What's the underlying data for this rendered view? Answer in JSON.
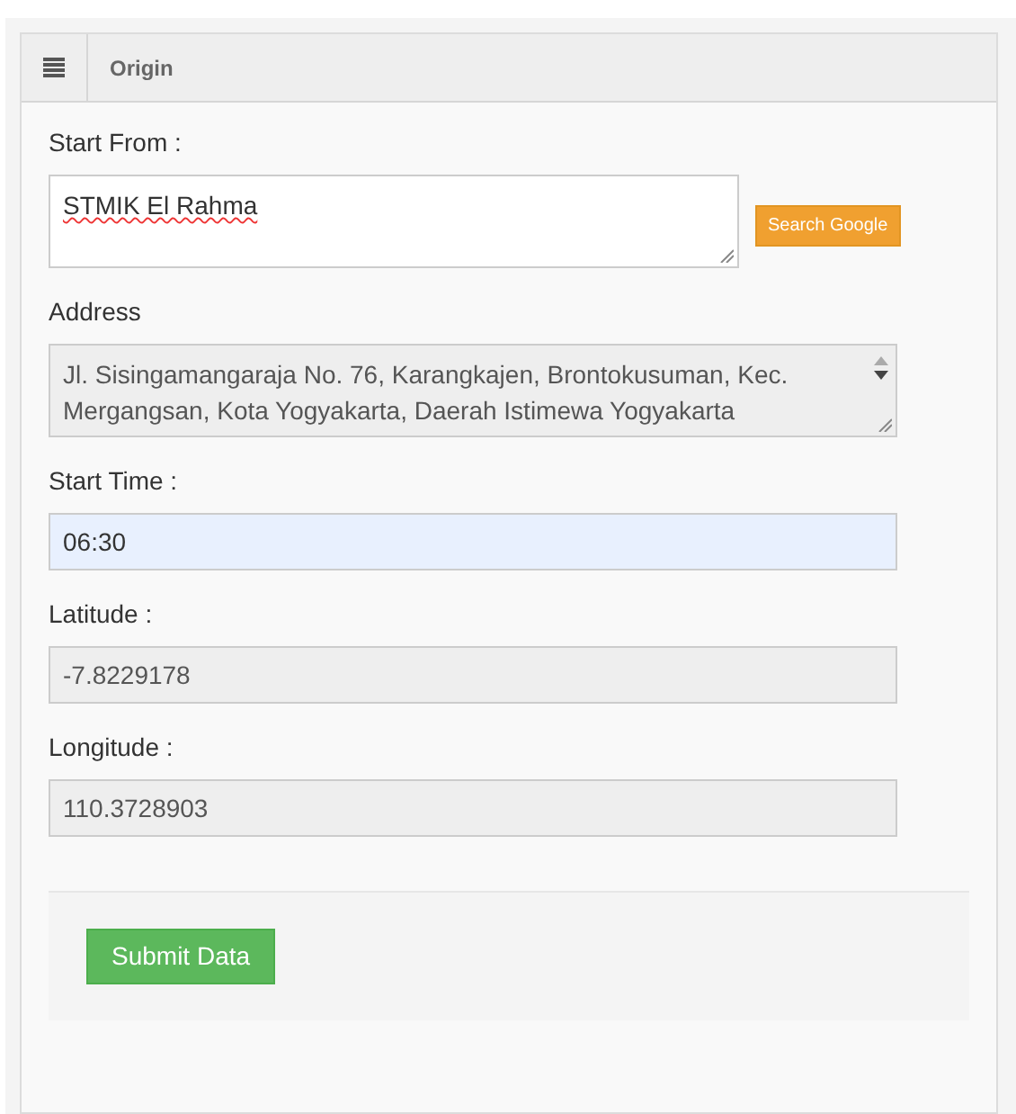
{
  "panel": {
    "title": "Origin"
  },
  "fields": [
    {
      "kind": "textarea",
      "label": "Start From :",
      "value": "STMIK El Rahma",
      "readonly": false,
      "focused": false,
      "spellcheck_errors": true,
      "button": "Search Google"
    },
    {
      "kind": "textarea",
      "label": "Address",
      "value": "Jl. Sisingamangaraja No. 76, Karangkajen, Brontokusuman, Kec. Mergangsan, Kota Yogyakarta, Daerah Istimewa Yogyakarta",
      "readonly": true,
      "focused": false,
      "spellcheck_errors": false
    },
    {
      "kind": "input",
      "label": "Start Time :",
      "value": "06:30",
      "readonly": false,
      "focused": true
    },
    {
      "kind": "input",
      "label": "Latitude :",
      "value": "-7.8229178",
      "readonly": true,
      "focused": false
    },
    {
      "kind": "input",
      "label": "Longitude :",
      "value": "110.3728903",
      "readonly": true,
      "focused": false
    }
  ],
  "submit": "Submit Data"
}
